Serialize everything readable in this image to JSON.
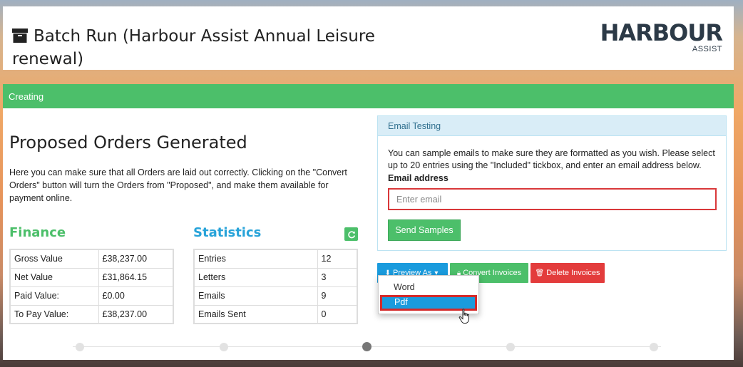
{
  "header": {
    "title": "Batch Run (Harbour Assist Annual Leisure renewal)",
    "logo_main": "HARBOUR",
    "logo_sub": "ASSIST"
  },
  "status": {
    "label": "Creating",
    "color": "#4cbf6a"
  },
  "orders": {
    "heading": "Proposed Orders Generated",
    "intro": "Here you can make sure that all Orders are laid out correctly. Clicking on the \"Convert Orders\" button will turn the Orders from \"Proposed\", and make them available for payment online."
  },
  "finance": {
    "title": "Finance",
    "rows": [
      {
        "label": "Gross Value",
        "value": "£38,237.00"
      },
      {
        "label": "Net Value",
        "value": "£31,864.15"
      },
      {
        "label": "Paid Value:",
        "value": "£0.00"
      },
      {
        "label": "To Pay Value:",
        "value": "£38,237.00"
      }
    ]
  },
  "statistics": {
    "title": "Statistics",
    "refresh_icon": "refresh-icon",
    "rows": [
      {
        "label": "Entries",
        "value": "12"
      },
      {
        "label": "Letters",
        "value": "3"
      },
      {
        "label": "Emails",
        "value": "9"
      },
      {
        "label": "Emails Sent",
        "value": "0"
      }
    ]
  },
  "email_testing": {
    "heading": "Email Testing",
    "description": "You can sample emails to make sure they are formatted as you wish. Please select up to 20 entries using the \"Included\" tickbox, and enter an email address below.",
    "label": "Email address",
    "placeholder": "Enter email",
    "value": "",
    "send_label": "Send Samples"
  },
  "actions": {
    "preview_label": "Preview As",
    "convert_label": "Convert Invoices",
    "delete_label": "Delete Invoices"
  },
  "preview_menu": {
    "items": [
      "Word",
      "Pdf"
    ],
    "selected": "Pdf"
  },
  "stepper": {
    "steps": 5,
    "active_step": 3
  },
  "colors": {
    "success": "#4cbf6a",
    "info": "#1a9bdd",
    "danger": "#e33c3c",
    "statistics": "#27a3d9"
  }
}
